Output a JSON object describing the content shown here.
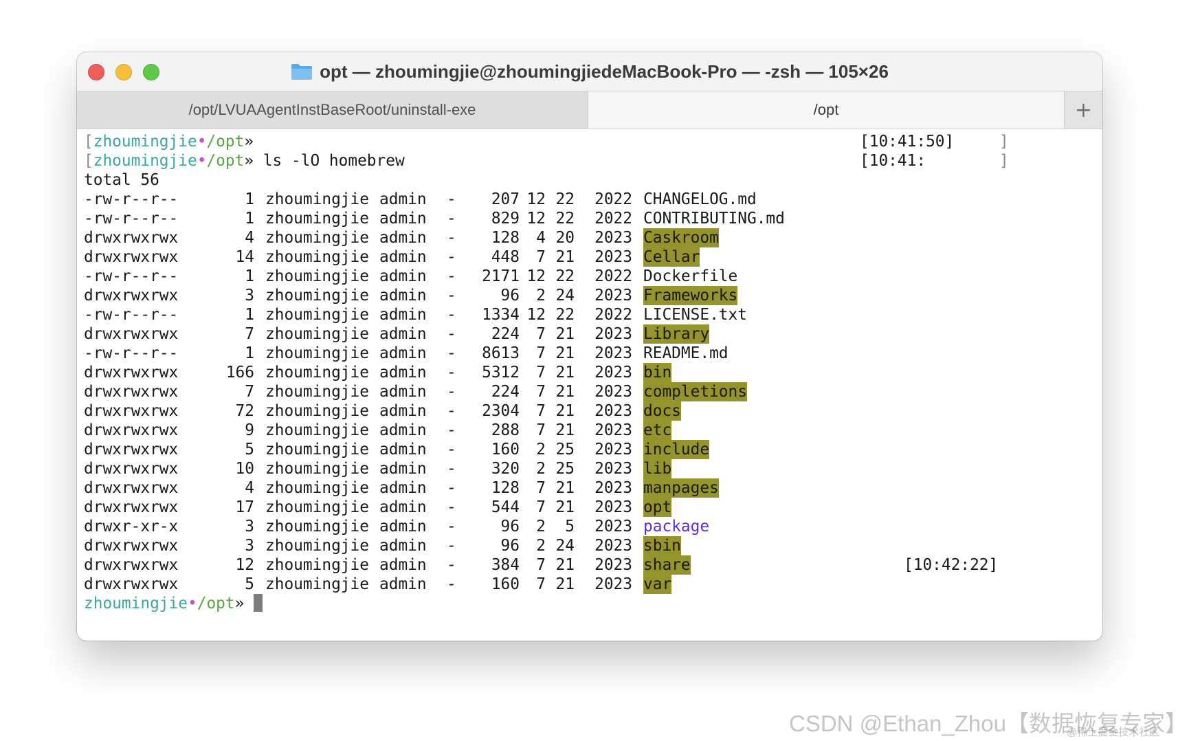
{
  "window": {
    "title": "opt — zhoumingjie@zhoumingjiedeMacBook-Pro — -zsh — 105×26",
    "title_icon": "folder-icon"
  },
  "tabs": [
    {
      "label": "/opt/LVUAAgentInstBaseRoot/uninstall-exe",
      "active": false
    },
    {
      "label": "/opt",
      "active": true
    }
  ],
  "new_tab_label": "+",
  "prompt": {
    "user": "zhoumingjie",
    "dot": "•",
    "path": "/opt",
    "arrow": "»"
  },
  "history": [
    {
      "command": "",
      "timestamp": "[10:41:50]"
    },
    {
      "command": "ls -lO homebrew",
      "timestamp": "[10:41:"
    }
  ],
  "total_line": "total 56",
  "listing": [
    {
      "perm": "-rw-r--r--",
      "links": "1",
      "owner": "zhoumingjie",
      "group": "admin",
      "flags": "-",
      "size": "207",
      "month": "12",
      "day": "22",
      "year": "2022",
      "name": "CHANGELOG.md",
      "type": "file"
    },
    {
      "perm": "-rw-r--r--",
      "links": "1",
      "owner": "zhoumingjie",
      "group": "admin",
      "flags": "-",
      "size": "829",
      "month": "12",
      "day": "22",
      "year": "2022",
      "name": "CONTRIBUTING.md",
      "type": "file"
    },
    {
      "perm": "drwxrwxrwx",
      "links": "4",
      "owner": "zhoumingjie",
      "group": "admin",
      "flags": "-",
      "size": "128",
      "month": "4",
      "day": "20",
      "year": "2023",
      "name": "Caskroom",
      "type": "dir"
    },
    {
      "perm": "drwxrwxrwx",
      "links": "14",
      "owner": "zhoumingjie",
      "group": "admin",
      "flags": "-",
      "size": "448",
      "month": "7",
      "day": "21",
      "year": "2023",
      "name": "Cellar",
      "type": "dir"
    },
    {
      "perm": "-rw-r--r--",
      "links": "1",
      "owner": "zhoumingjie",
      "group": "admin",
      "flags": "-",
      "size": "2171",
      "month": "12",
      "day": "22",
      "year": "2022",
      "name": "Dockerfile",
      "type": "file"
    },
    {
      "perm": "drwxrwxrwx",
      "links": "3",
      "owner": "zhoumingjie",
      "group": "admin",
      "flags": "-",
      "size": "96",
      "month": "2",
      "day": "24",
      "year": "2023",
      "name": "Frameworks",
      "type": "dir"
    },
    {
      "perm": "-rw-r--r--",
      "links": "1",
      "owner": "zhoumingjie",
      "group": "admin",
      "flags": "-",
      "size": "1334",
      "month": "12",
      "day": "22",
      "year": "2022",
      "name": "LICENSE.txt",
      "type": "file"
    },
    {
      "perm": "drwxrwxrwx",
      "links": "7",
      "owner": "zhoumingjie",
      "group": "admin",
      "flags": "-",
      "size": "224",
      "month": "7",
      "day": "21",
      "year": "2023",
      "name": "Library",
      "type": "dir"
    },
    {
      "perm": "-rw-r--r--",
      "links": "1",
      "owner": "zhoumingjie",
      "group": "admin",
      "flags": "-",
      "size": "8613",
      "month": "7",
      "day": "21",
      "year": "2023",
      "name": "README.md",
      "type": "file"
    },
    {
      "perm": "drwxrwxrwx",
      "links": "166",
      "owner": "zhoumingjie",
      "group": "admin",
      "flags": "-",
      "size": "5312",
      "month": "7",
      "day": "21",
      "year": "2023",
      "name": "bin",
      "type": "dir"
    },
    {
      "perm": "drwxrwxrwx",
      "links": "7",
      "owner": "zhoumingjie",
      "group": "admin",
      "flags": "-",
      "size": "224",
      "month": "7",
      "day": "21",
      "year": "2023",
      "name": "completions",
      "type": "dir"
    },
    {
      "perm": "drwxrwxrwx",
      "links": "72",
      "owner": "zhoumingjie",
      "group": "admin",
      "flags": "-",
      "size": "2304",
      "month": "7",
      "day": "21",
      "year": "2023",
      "name": "docs",
      "type": "dir"
    },
    {
      "perm": "drwxrwxrwx",
      "links": "9",
      "owner": "zhoumingjie",
      "group": "admin",
      "flags": "-",
      "size": "288",
      "month": "7",
      "day": "21",
      "year": "2023",
      "name": "etc",
      "type": "dir"
    },
    {
      "perm": "drwxrwxrwx",
      "links": "5",
      "owner": "zhoumingjie",
      "group": "admin",
      "flags": "-",
      "size": "160",
      "month": "2",
      "day": "25",
      "year": "2023",
      "name": "include",
      "type": "dir"
    },
    {
      "perm": "drwxrwxrwx",
      "links": "10",
      "owner": "zhoumingjie",
      "group": "admin",
      "flags": "-",
      "size": "320",
      "month": "2",
      "day": "25",
      "year": "2023",
      "name": "lib",
      "type": "dir"
    },
    {
      "perm": "drwxrwxrwx",
      "links": "4",
      "owner": "zhoumingjie",
      "group": "admin",
      "flags": "-",
      "size": "128",
      "month": "7",
      "day": "21",
      "year": "2023",
      "name": "manpages",
      "type": "dir"
    },
    {
      "perm": "drwxrwxrwx",
      "links": "17",
      "owner": "zhoumingjie",
      "group": "admin",
      "flags": "-",
      "size": "544",
      "month": "7",
      "day": "21",
      "year": "2023",
      "name": "opt",
      "type": "dir"
    },
    {
      "perm": "drwxr-xr-x",
      "links": "3",
      "owner": "zhoumingjie",
      "group": "admin",
      "flags": "-",
      "size": "96",
      "month": "2",
      "day": "5",
      "year": "2023",
      "name": "package",
      "type": "link"
    },
    {
      "perm": "drwxrwxrwx",
      "links": "3",
      "owner": "zhoumingjie",
      "group": "admin",
      "flags": "-",
      "size": "96",
      "month": "2",
      "day": "24",
      "year": "2023",
      "name": "sbin",
      "type": "dir"
    },
    {
      "perm": "drwxrwxrwx",
      "links": "12",
      "owner": "zhoumingjie",
      "group": "admin",
      "flags": "-",
      "size": "384",
      "month": "7",
      "day": "21",
      "year": "2023",
      "name": "share",
      "type": "dir"
    },
    {
      "perm": "drwxrwxrwx",
      "links": "5",
      "owner": "zhoumingjie",
      "group": "admin",
      "flags": "-",
      "size": "160",
      "month": "7",
      "day": "21",
      "year": "2023",
      "name": "var",
      "type": "dir"
    }
  ],
  "current_prompt_timestamp": "[10:42:22]",
  "watermark": "CSDN @Ethan_Zhou【数据恢复专家】",
  "watermark_small": "@稀土掘金技术社区",
  "colors": {
    "dir_highlight": "#95932c",
    "prompt_user": "#3aa6a6",
    "prompt_dot": "#c84fc8",
    "prompt_path": "#5aa643",
    "link_name": "#5a2fd8"
  }
}
